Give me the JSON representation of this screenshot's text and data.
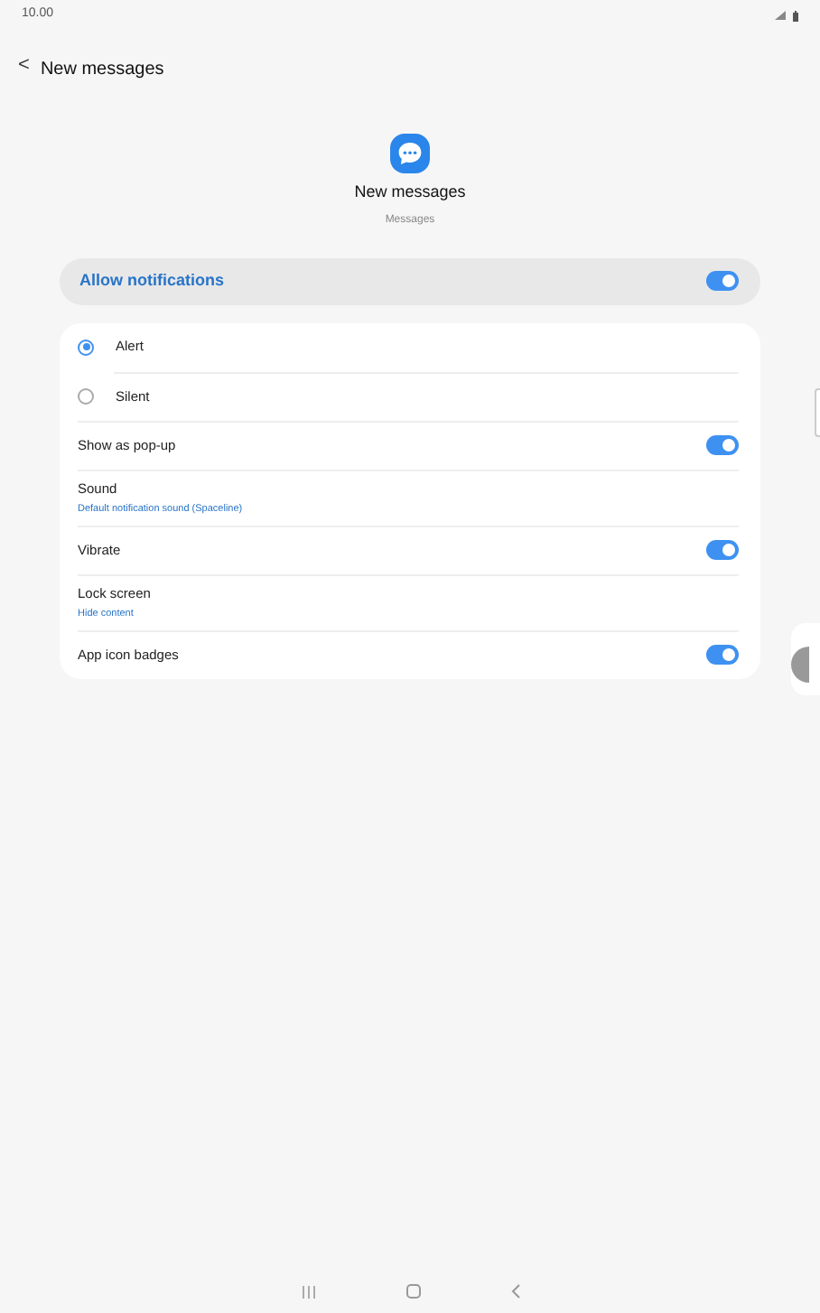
{
  "status_bar": {
    "time": "10.00"
  },
  "header": {
    "back": "<",
    "title": "New messages"
  },
  "app": {
    "title": "New messages",
    "subtitle": "Messages"
  },
  "master": {
    "label": "Allow notifications",
    "on": true
  },
  "settings": [
    {
      "kind": "radio",
      "label": "Alert",
      "selected": true
    },
    {
      "kind": "radio",
      "label": "Silent",
      "selected": false
    },
    {
      "kind": "toggle",
      "label": "Show as pop-up",
      "on": true
    },
    {
      "kind": "link",
      "label": "Sound",
      "value": "Default notification sound (Spaceline)"
    },
    {
      "kind": "toggle",
      "label": "Vibrate",
      "on": true
    },
    {
      "kind": "link",
      "label": "Lock screen",
      "value": "Hide content"
    },
    {
      "kind": "toggle",
      "label": "App icon badges",
      "on": true
    }
  ]
}
